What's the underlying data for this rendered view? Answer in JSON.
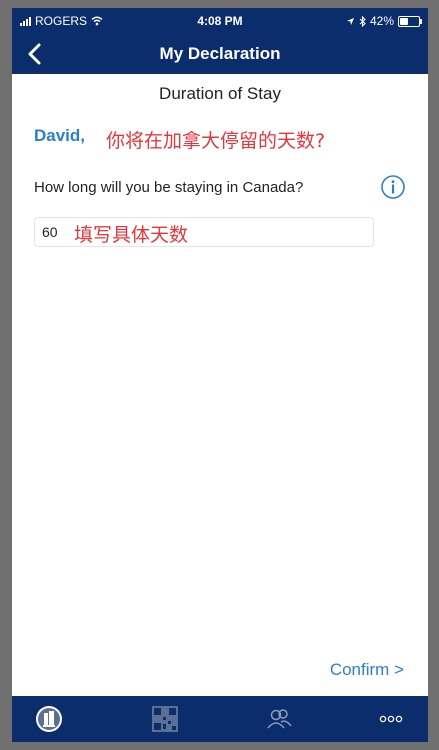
{
  "status_bar": {
    "carrier": "ROGERS",
    "time": "4:08 PM",
    "battery": "42%",
    "battery_level": 0.42
  },
  "nav": {
    "title": "My Declaration",
    "back_icon": "chevron-left-icon"
  },
  "content": {
    "section_title": "Duration of Stay",
    "greeting_name": "David,",
    "annotation_question": "你将在加拿大停留的天数?",
    "question": "How long will you be staying in Canada?",
    "info_icon": "info-circle-icon",
    "field_value": "60",
    "annotation_field": "填写具体天数"
  },
  "footer": {
    "confirm_label": "Confirm >"
  },
  "tabbar": {
    "items": [
      "profile-icon",
      "qr-code-icon",
      "people-icon",
      "more-icon"
    ]
  },
  "colors": {
    "nav_bg": "#0b2d6b",
    "accent_blue": "#2d7fc6",
    "annotation_red": "#e0383c"
  }
}
